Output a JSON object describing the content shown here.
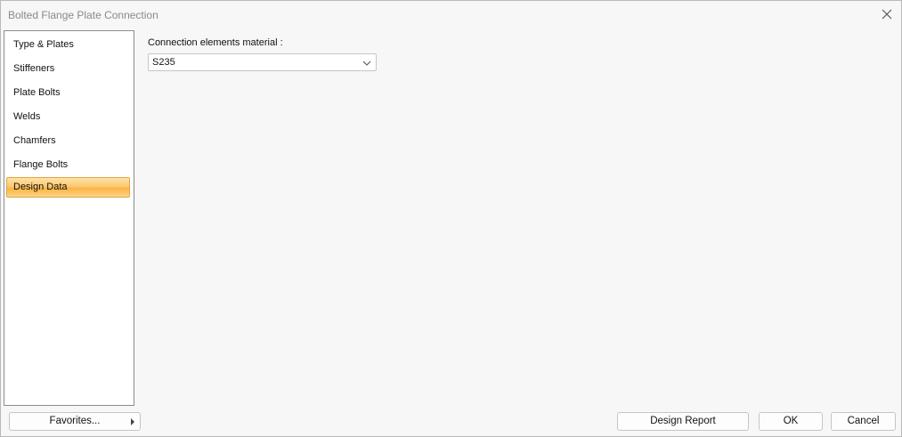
{
  "window": {
    "title": "Bolted Flange Plate Connection",
    "close_icon": "close-icon"
  },
  "sidebar": {
    "items": [
      {
        "label": "Type & Plates",
        "active": false
      },
      {
        "label": "Stiffeners",
        "active": false
      },
      {
        "label": "Plate Bolts",
        "active": false
      },
      {
        "label": "Welds",
        "active": false
      },
      {
        "label": "Chamfers",
        "active": false
      },
      {
        "label": "Flange Bolts",
        "active": false
      },
      {
        "label": "Design Data",
        "active": true
      }
    ]
  },
  "main": {
    "material_label": "Connection elements material :",
    "material_value": "S235",
    "chevron_icon": "chevron-down-icon"
  },
  "footer": {
    "favorites_label": "Favorites...",
    "design_report_label": "Design Report",
    "ok_label": "OK",
    "cancel_label": "Cancel"
  },
  "colors": {
    "active_item_top": "#fde3a6",
    "active_item_bottom": "#fbb446",
    "dialog_background": "#f7f7f7"
  }
}
